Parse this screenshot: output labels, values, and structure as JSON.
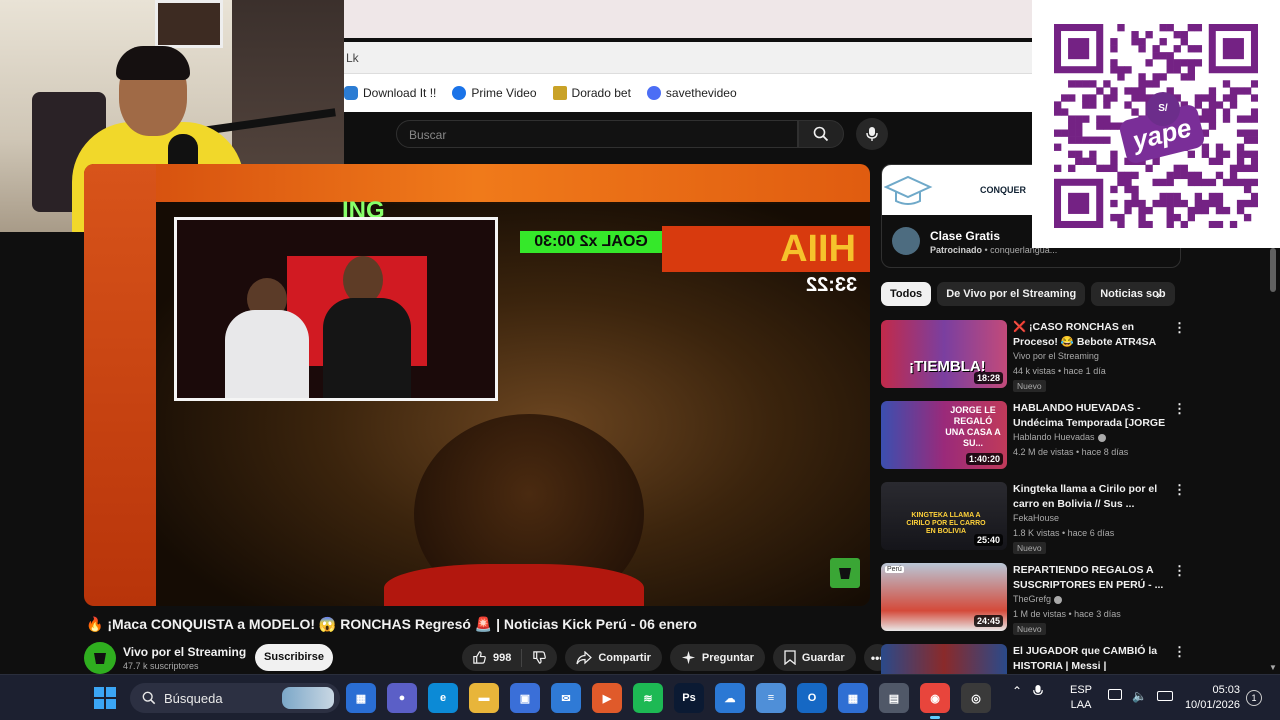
{
  "browser": {
    "address_text": "Lk",
    "bookmarks": [
      {
        "label": "Download It !!",
        "icon": "cloud-icon",
        "color": "#2b7cd3"
      },
      {
        "label": "Prime Video",
        "icon": "prime-video-icon",
        "color": "#1a73e8"
      },
      {
        "label": "Dorado bet",
        "icon": "dorado-bet-icon",
        "color": "#c9a227"
      },
      {
        "label": "savethevideo",
        "icon": "savethevideo-icon",
        "color": "#4c6ef5"
      }
    ]
  },
  "youtube": {
    "search_placeholder": "Buscar",
    "video": {
      "overlay_text_streaming": "ING",
      "overlay_goal": "GOAL x2 00:30",
      "overlay_timer": "33:22",
      "overlay_banner": "HIIA"
    },
    "title": "🔥 ¡Maca CONQUISTA a MODELO! 😱 RONCHAS Regresó 🚨 | Noticias Kick Perú - 06 enero",
    "channel": {
      "name": "Vivo por el Streaming",
      "subs": "47.7 k suscriptores"
    },
    "subscribe_label": "Suscribirse",
    "actions": {
      "likes": "998",
      "share": "Compartir",
      "ask": "Preguntar",
      "save": "Guardar"
    },
    "ad": {
      "brand": "CONQUER",
      "title": "Clase Gratis",
      "sponsored": "Patrocinado",
      "domain": "• conquerlangua..."
    },
    "chips": [
      "Todos",
      "De Vivo por el Streaming",
      "Noticias sob"
    ],
    "recommendations": [
      {
        "title": "❌ ¡CASO RONCHAS en Proceso! 😂 Bebote ATR4SA ...",
        "channel": "Vivo por el Streaming",
        "meta": "44 k vistas • hace 1 día",
        "badge": "Nuevo",
        "duration": "18:28",
        "thumb_text": "¡TIEMBLA!",
        "verified": false
      },
      {
        "title": "HABLANDO HUEVADAS - Undécima Temporada [JORGE ...",
        "channel": "Hablando Huevadas",
        "meta": "4.2 M de vistas • hace 8 días",
        "badge": "",
        "duration": "1:40:20",
        "thumb_text": "JORGE LE REGALÓ UNA CASA A SU...",
        "verified": true
      },
      {
        "title": "Kingteka llama a Cirilo por el carro en Bolivia // Sus ...",
        "channel": "FekaHouse",
        "meta": "1.8 K vistas • hace 6 días",
        "badge": "Nuevo",
        "duration": "25:40",
        "thumb_text": "KINGTEKA LLAMA A CIRILO POR EL CARRO EN BOLIVIA",
        "verified": false
      },
      {
        "title": "REPARTIENDO REGALOS A SUSCRIPTORES EN PERÚ - ...",
        "channel": "TheGrefg",
        "meta": "1 M de vistas • hace 3 días",
        "badge": "Nuevo",
        "duration": "24:45",
        "thumb_text": "Perú",
        "verified": true
      },
      {
        "title": "El JUGADOR que CAMBIÓ la HISTORIA | Messi | Documental",
        "channel": "",
        "meta": "",
        "badge": "",
        "duration": "",
        "thumb_text": "",
        "verified": false
      }
    ]
  },
  "qr": {
    "badge": "S/",
    "brand": "yape",
    "color": "#742284"
  },
  "taskbar": {
    "search_label": "Búsqueda",
    "apps": [
      {
        "name": "file-explorer-icon",
        "color": "#2a6ed4",
        "glyph": "▦"
      },
      {
        "name": "teams-icon",
        "color": "#5b5fc7",
        "glyph": "●"
      },
      {
        "name": "edge-icon",
        "color": "#0c8ad6",
        "glyph": "e"
      },
      {
        "name": "folder-icon",
        "color": "#e8b53a",
        "glyph": "▬"
      },
      {
        "name": "store-icon",
        "color": "#3a6fd8",
        "glyph": "▣"
      },
      {
        "name": "mail-icon",
        "color": "#2f7ad6",
        "glyph": "✉"
      },
      {
        "name": "media-player-icon",
        "color": "#e05a2a",
        "glyph": "▶"
      },
      {
        "name": "spotify-icon",
        "color": "#1db954",
        "glyph": "≋"
      },
      {
        "name": "photoshop-icon",
        "color": "#0b1a33",
        "glyph": "Ps"
      },
      {
        "name": "onedrive-icon",
        "color": "#2b78d4",
        "glyph": "☁"
      },
      {
        "name": "notepad-icon",
        "color": "#4f8fd8",
        "glyph": "≡"
      },
      {
        "name": "outlook-icon",
        "color": "#1668c4",
        "glyph": "O"
      },
      {
        "name": "calendar-icon",
        "color": "#2f6fd3",
        "glyph": "▦"
      },
      {
        "name": "calculator-icon",
        "color": "#505868",
        "glyph": "▤"
      },
      {
        "name": "chrome-icon",
        "color": "#e8453c",
        "glyph": "◉"
      },
      {
        "name": "obs-icon",
        "color": "#3a3a3a",
        "glyph": "◎"
      }
    ],
    "lang_top": "ESP",
    "lang_bottom": "LAA",
    "time": "05:03",
    "date": "10/01/2026",
    "notifications": "1"
  }
}
